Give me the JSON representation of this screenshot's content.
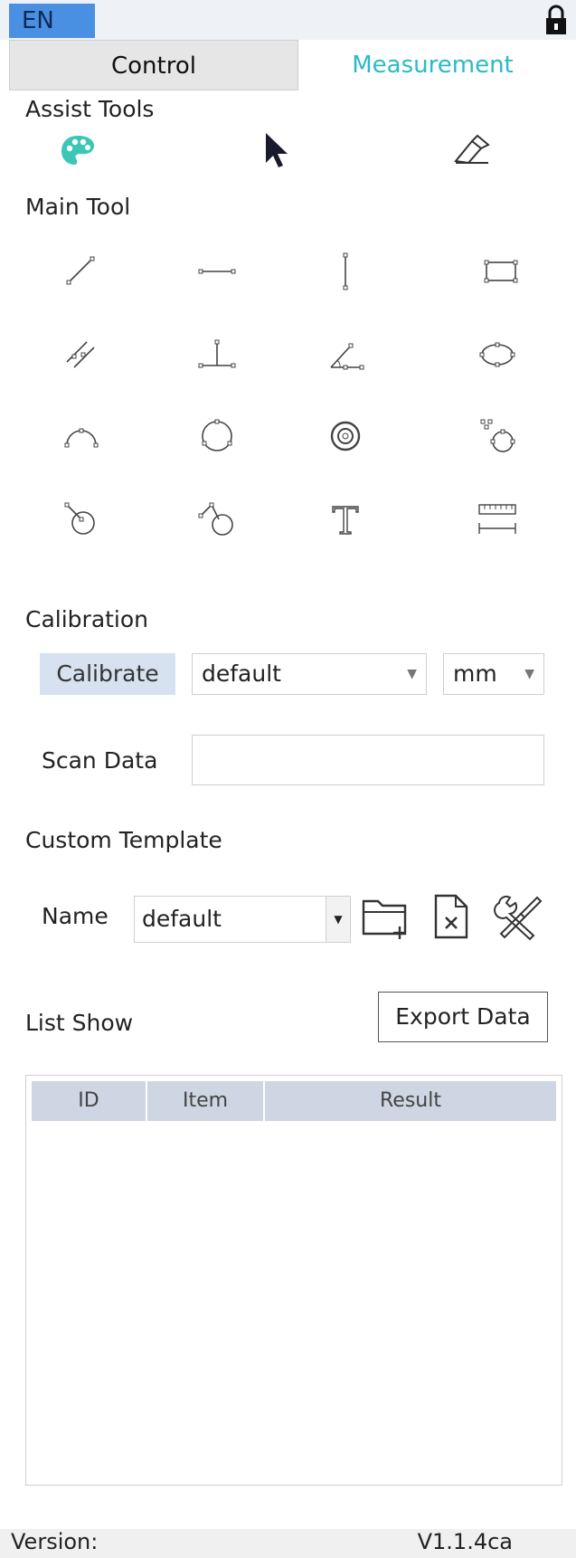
{
  "topbar": {
    "language": "EN"
  },
  "tabs": [
    {
      "label": "Control"
    },
    {
      "label": "Measurement"
    }
  ],
  "assist_tools": {
    "title": "Assist Tools",
    "items": [
      {
        "icon": "palette-icon"
      },
      {
        "icon": "pointer-icon"
      },
      {
        "icon": "eraser-icon"
      }
    ]
  },
  "main_tool": {
    "title": "Main Tool",
    "items": [
      {
        "icon": "line-icon"
      },
      {
        "icon": "horizontal-line-icon"
      },
      {
        "icon": "vertical-line-icon"
      },
      {
        "icon": "rectangle-icon"
      },
      {
        "icon": "parallel-lines-icon"
      },
      {
        "icon": "perpendicular-icon"
      },
      {
        "icon": "angle-icon"
      },
      {
        "icon": "ellipse-icon"
      },
      {
        "icon": "arc-icon"
      },
      {
        "icon": "circle-icon"
      },
      {
        "icon": "concentric-circle-icon"
      },
      {
        "icon": "points-circle-icon"
      },
      {
        "icon": "line-circle-icon"
      },
      {
        "icon": "angle-circle-icon"
      },
      {
        "icon": "text-icon"
      },
      {
        "icon": "ruler-icon"
      }
    ]
  },
  "calibration": {
    "title": "Calibration",
    "calibrate_label": "Calibrate",
    "profile_value": "default",
    "unit_value": "mm"
  },
  "scan_data": {
    "label": "Scan Data",
    "value": ""
  },
  "custom_template": {
    "title": "Custom Template",
    "name_label": "Name",
    "name_value": "default"
  },
  "list_show": {
    "title": "List Show",
    "export_label": "Export Data",
    "columns": [
      "ID",
      "Item",
      "Result"
    ]
  },
  "status": {
    "version_label": "Version:",
    "version_value": "V1.1.4ca"
  },
  "colors": {
    "accent": "#2bbac7",
    "lang_bg": "#4a90e2",
    "calibrate_bg": "#d6e2f0",
    "table_header_bg": "#cdd6e2"
  }
}
